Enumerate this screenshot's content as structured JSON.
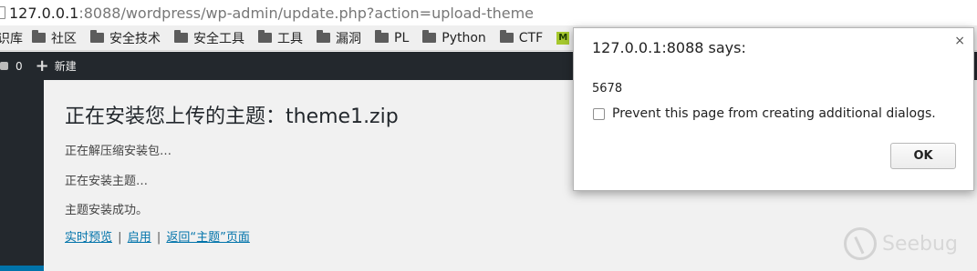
{
  "browser": {
    "url_host": "127.0.0.1",
    "url_rest": ":8088/wordpress/wp-admin/update.php?action=upload-theme"
  },
  "bookmarks": [
    {
      "label": "识库",
      "icon": "none"
    },
    {
      "label": "社区",
      "icon": "folder-icon"
    },
    {
      "label": "安全技术",
      "icon": "folder-icon"
    },
    {
      "label": "安全工具",
      "icon": "folder-icon"
    },
    {
      "label": "工具",
      "icon": "folder-icon"
    },
    {
      "label": "漏洞",
      "icon": "folder-icon"
    },
    {
      "label": "PL",
      "icon": "folder-icon"
    },
    {
      "label": "Python",
      "icon": "folder-icon"
    },
    {
      "label": "CTF",
      "icon": "folder-icon"
    },
    {
      "label": "M",
      "icon": "m-badge-icon"
    }
  ],
  "adminbar": {
    "comments_count": "0",
    "new_label": "新建"
  },
  "main": {
    "title": "正在安装您上传的主题：theme1.zip",
    "messages": [
      "正在解压缩安装包…",
      "正在安装主题…",
      "主题安装成功。"
    ],
    "links": {
      "preview": "实时预览",
      "activate": "启用",
      "back": "返回“主题”页面",
      "separator": "|"
    }
  },
  "watermark": {
    "text": "Seebug"
  },
  "dialog": {
    "title": "127.0.0.1:8088 says:",
    "message": "5678",
    "checkbox_label": "Prevent this page from creating additional dialogs.",
    "ok_label": "OK",
    "close_symbol": "×"
  }
}
